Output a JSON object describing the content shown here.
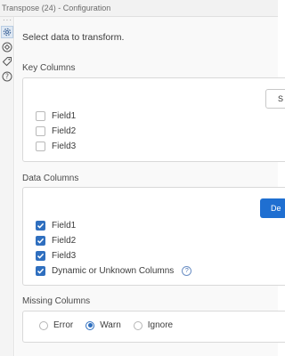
{
  "window": {
    "title": "Transpose (24) - Configuration"
  },
  "sidebar": {
    "handle": "···",
    "icons": [
      "gear-icon",
      "connections-icon",
      "tag-icon",
      "help-icon"
    ]
  },
  "main": {
    "intro": "Select data to transform.",
    "key_columns": {
      "label": "Key Columns",
      "button_label": "S",
      "fields": [
        {
          "label": "Field1",
          "checked": false
        },
        {
          "label": "Field2",
          "checked": false
        },
        {
          "label": "Field3",
          "checked": false
        }
      ]
    },
    "data_columns": {
      "label": "Data Columns",
      "button_label": "De",
      "fields": [
        {
          "label": "Field1",
          "checked": true
        },
        {
          "label": "Field2",
          "checked": true
        },
        {
          "label": "Field3",
          "checked": true
        },
        {
          "label": "Dynamic or Unknown Columns",
          "checked": true
        }
      ],
      "help_glyph": "?"
    },
    "missing_columns": {
      "label": "Missing Columns",
      "options": [
        {
          "label": "Error",
          "selected": false
        },
        {
          "label": "Warn",
          "selected": true
        },
        {
          "label": "Ignore",
          "selected": false
        }
      ]
    }
  },
  "colors": {
    "accent": "#2f6fbf",
    "primary_button": "#1f6fd1"
  }
}
